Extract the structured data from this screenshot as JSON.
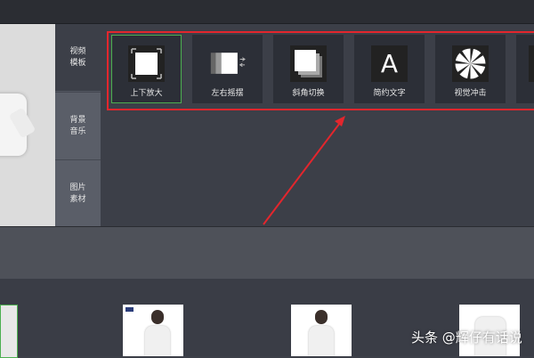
{
  "tabs": [
    {
      "label": "视频模板"
    },
    {
      "label": "背景音乐"
    },
    {
      "label": "图片素材"
    }
  ],
  "templates": [
    {
      "label": "上下放大",
      "icon": "zoom-updown-icon",
      "selected": true
    },
    {
      "label": "左右摇摆",
      "icon": "swing-leftright-icon"
    },
    {
      "label": "斜角切换",
      "icon": "diagonal-switch-icon"
    },
    {
      "label": "简约文字",
      "icon": "simple-text-icon",
      "glyph": "A"
    },
    {
      "label": "视觉冲击",
      "icon": "visual-impact-icon"
    }
  ],
  "highlight_color": "#e3262d",
  "selected_color": "#4caf50",
  "watermark": "头条 @辉仔有话说"
}
